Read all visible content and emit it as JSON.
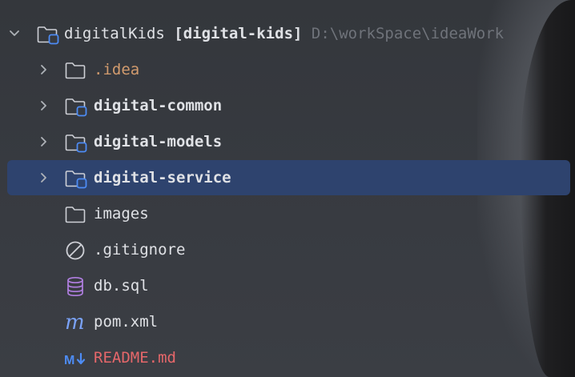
{
  "tree": {
    "root": {
      "name": "digitalKids",
      "module_name": "[digital-kids]",
      "path": "D:\\workSpace\\ideaWork"
    },
    "items": [
      {
        "label": ".idea",
        "icon": "folder-icon",
        "expandable": true
      },
      {
        "label": "digital-common",
        "icon": "module-folder-icon",
        "expandable": true
      },
      {
        "label": "digital-models",
        "icon": "module-folder-icon",
        "expandable": true
      },
      {
        "label": "digital-service",
        "icon": "module-folder-icon",
        "expandable": true,
        "selected": true
      },
      {
        "label": "images",
        "icon": "folder-icon",
        "expandable": false
      },
      {
        "label": ".gitignore",
        "icon": "ignored-file-icon",
        "expandable": false
      },
      {
        "label": "db.sql",
        "icon": "database-icon",
        "expandable": false
      },
      {
        "label": "pom.xml",
        "icon": "maven-icon",
        "expandable": false
      },
      {
        "label": "README.md",
        "icon": "markdown-icon",
        "expandable": false
      }
    ]
  },
  "colors": {
    "background": "#373a40",
    "selection": "#2e436e",
    "text": "#dfe1e5",
    "excluded_folder_text": "#d29b6e",
    "modified_file_text": "#e5676a",
    "path_text": "#6f737a",
    "module_badge": "#4d8cf5",
    "database_icon": "#b07ee0",
    "maven_icon": "#7aa2f7",
    "markdown_icon": "#4d8cf5"
  }
}
